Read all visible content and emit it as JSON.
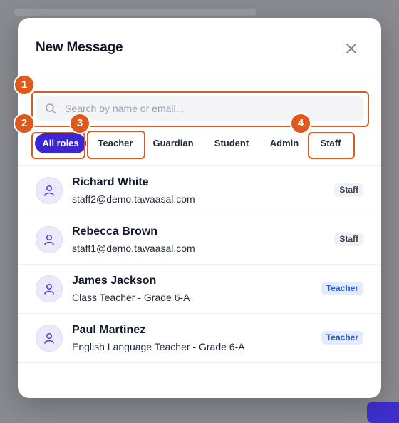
{
  "modal": {
    "title": "New Message"
  },
  "search": {
    "placeholder": "Search by name or email..."
  },
  "filters": {
    "items": [
      {
        "label": "All roles",
        "active": true
      },
      {
        "label": "Teacher",
        "active": false
      },
      {
        "label": "Guardian",
        "active": false
      },
      {
        "label": "Student",
        "active": false
      },
      {
        "label": "Admin",
        "active": false
      },
      {
        "label": "Staff",
        "active": false
      }
    ]
  },
  "contacts": [
    {
      "name": "Richard White",
      "detail": "staff2@demo.tawaasal.com",
      "role": "Staff"
    },
    {
      "name": "Rebecca Brown",
      "detail": "staff1@demo.tawaasal.com",
      "role": "Staff"
    },
    {
      "name": "James Jackson",
      "detail": "Class Teacher - Grade 6-A",
      "role": "Teacher"
    },
    {
      "name": "Paul Martinez",
      "detail": "English Language Teacher - Grade 6-A",
      "role": "Teacher"
    }
  ],
  "annotations": [
    "1",
    "2",
    "3",
    "4"
  ],
  "icons": {
    "close": "close-icon",
    "search": "search-icon",
    "avatar": "user-icon"
  },
  "colors": {
    "accent": "#3b26d6",
    "annotation": "#e0591c",
    "teacher_badge_bg": "#e3ecfd",
    "teacher_badge_text": "#2b5bd8",
    "staff_badge_bg": "#f1f2f4"
  }
}
